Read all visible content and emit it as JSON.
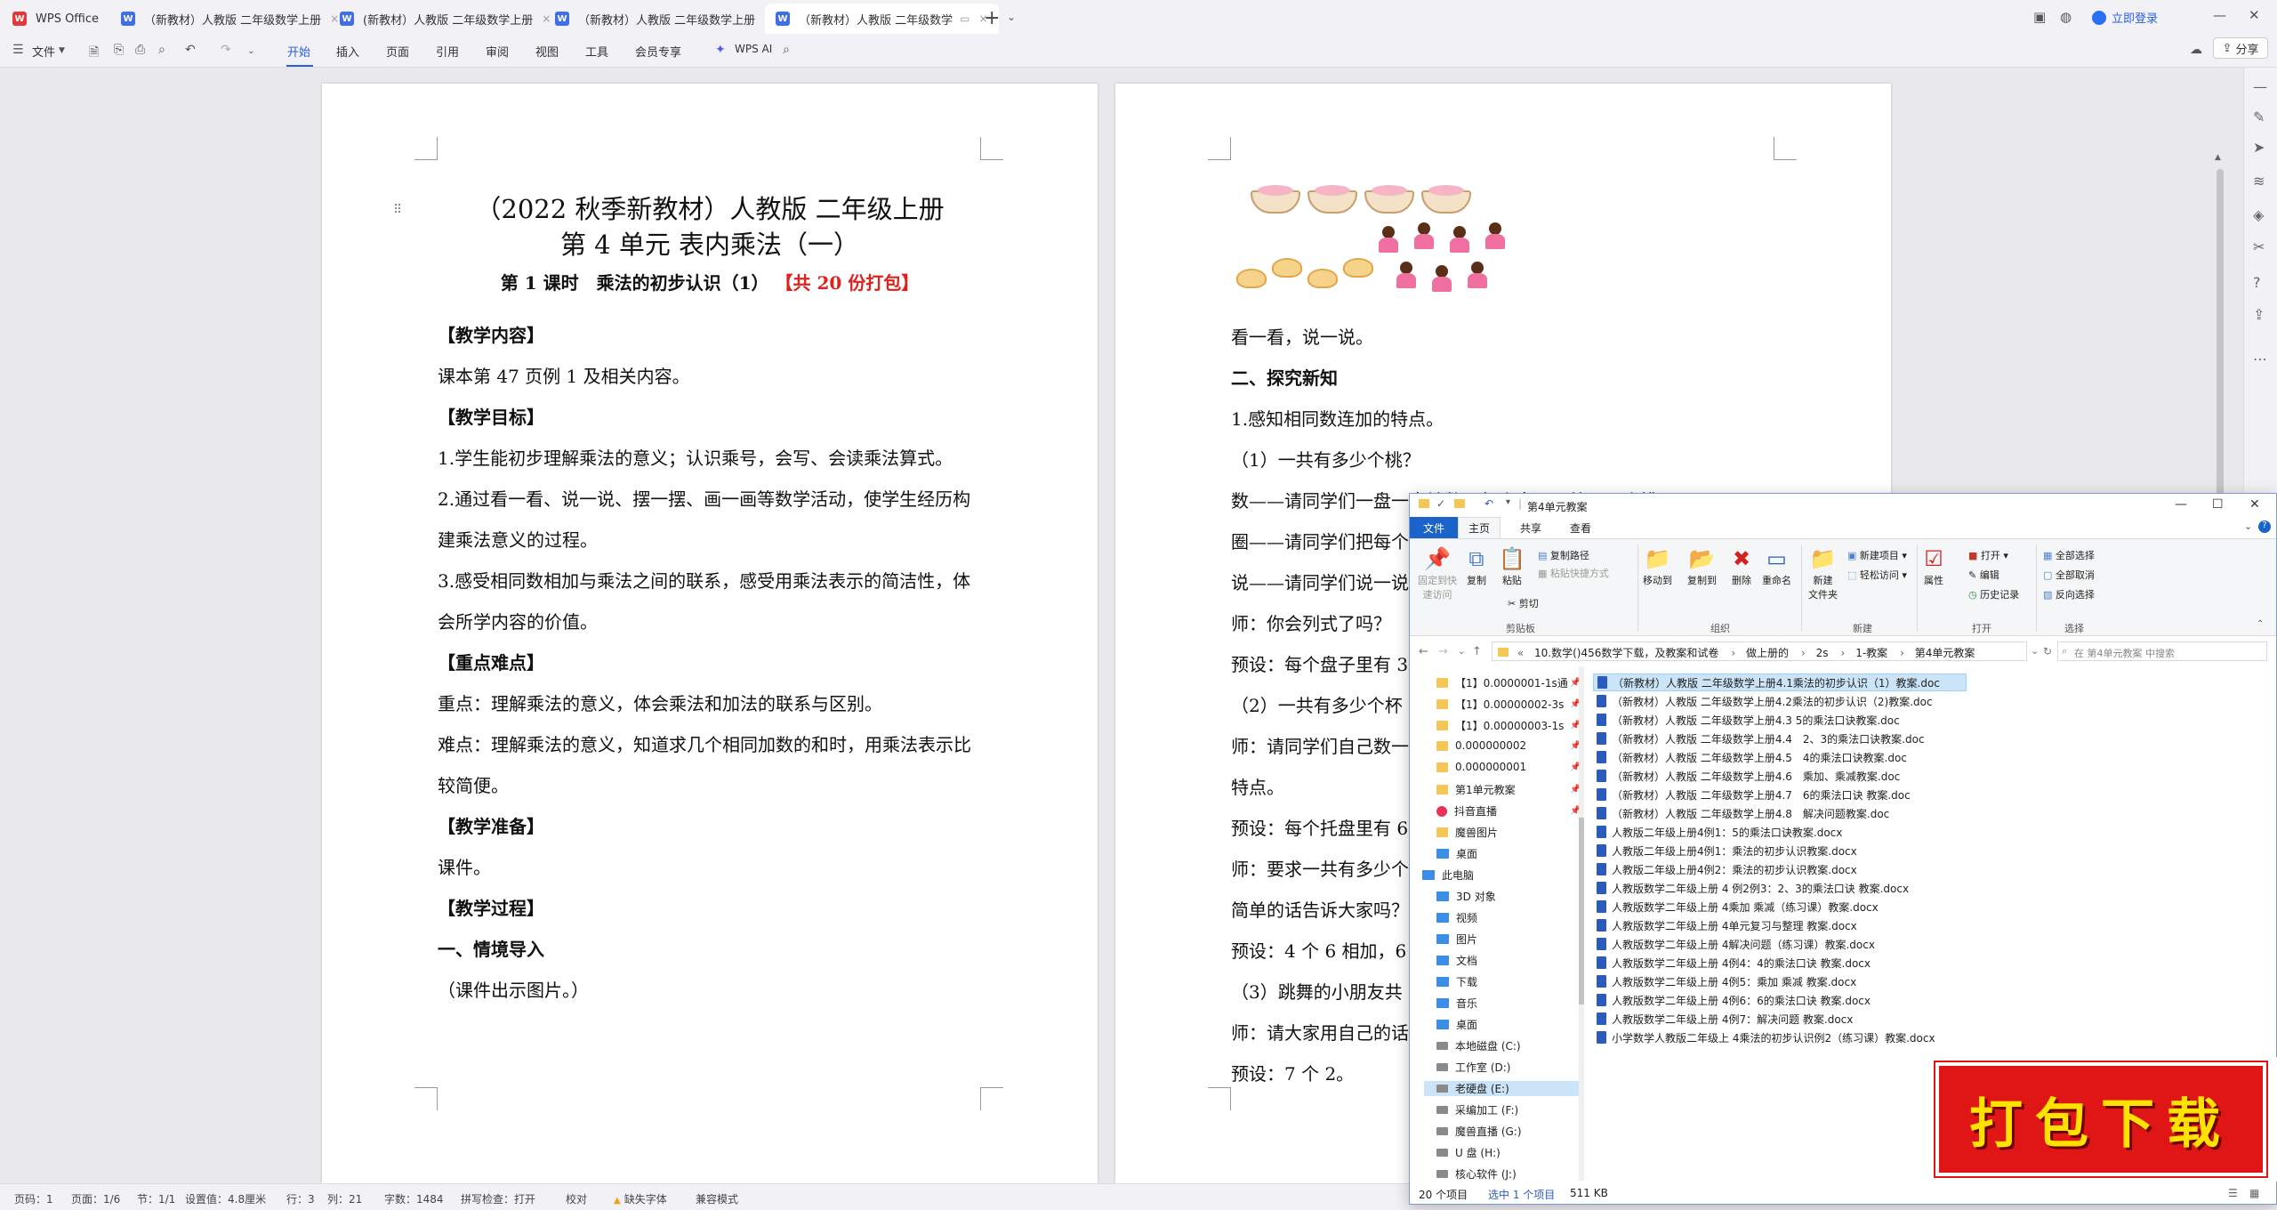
{
  "tabs": [
    {
      "label": "WPS Office"
    },
    {
      "label": "（新教材）人教版 二年级数学上册"
    },
    {
      "label": "(新教材）人教版 二年级数学上册"
    },
    {
      "label": "（新教材）人教版 二年级数学上册"
    },
    {
      "label": "（新教材）人教版 二年级数学"
    }
  ],
  "login_label": "立即登录",
  "share_label": "分享",
  "ribbon": {
    "file_label": "文件",
    "menus": [
      "开始",
      "插入",
      "页面",
      "引用",
      "审阅",
      "视图",
      "工具",
      "会员专享"
    ],
    "wps_ai": "WPS AI"
  },
  "page1": {
    "title_line1": "（2022 秋季新教材）人教版 二年级上册",
    "title_line2": "第 4 单元 表内乘法（一）",
    "lesson": "第 1 课时　乘法的初步认识（1）",
    "lesson_red": "【共 20 份打包】",
    "lines": [
      {
        "text": "【教学内容】",
        "bold": true
      },
      {
        "text": "课本第 47 页例 1 及相关内容。",
        "bold": false
      },
      {
        "text": "【教学目标】",
        "bold": true
      },
      {
        "text": "1.学生能初步理解乘法的意义；认识乘号，会写、会读乘法算式。",
        "bold": false
      },
      {
        "text": "2.通过看一看、说一说、摆一摆、画一画等数学活动，使学生经历构",
        "bold": false
      },
      {
        "text": "建乘法意义的过程。",
        "bold": false
      },
      {
        "text": "3.感受相同数相加与乘法之间的联系，感受用乘法表示的简洁性，体",
        "bold": false
      },
      {
        "text": "会所学内容的价值。",
        "bold": false
      },
      {
        "text": "【重点难点】",
        "bold": true
      },
      {
        "text": "重点：理解乘法的意义，体会乘法和加法的联系与区别。",
        "bold": false
      },
      {
        "text": "难点：理解乘法的意义，知道求几个相同加数的和时，用乘法表示比",
        "bold": false
      },
      {
        "text": "较简便。",
        "bold": false
      },
      {
        "text": "【教学准备】",
        "bold": true
      },
      {
        "text": "课件。",
        "bold": false
      },
      {
        "text": "【教学过程】",
        "bold": true
      },
      {
        "text": "一、情境导入",
        "bold": true
      },
      {
        "text": "（课件出示图片。）",
        "bold": false
      }
    ]
  },
  "page2": {
    "lines": [
      {
        "text": "看一看，说一说。",
        "bold": false
      },
      {
        "text": "二、探究新知",
        "bold": true
      },
      {
        "text": "1.感知相同数连加的特点。",
        "bold": false
      },
      {
        "text": "（1）一共有多少个桃？",
        "bold": false
      },
      {
        "text": "数——请同学们一盘一盘地数，每个盘子里放了几个桃？",
        "bold": false
      },
      {
        "text": "圈——请同学们把每个",
        "bold": false
      },
      {
        "text": "说——请同学们说一说",
        "bold": false
      },
      {
        "text": "师：你会列式了吗？",
        "bold": false
      },
      {
        "text": "预设：每个盘子里有 3",
        "bold": false
      },
      {
        "text": "（2）一共有多少个杯",
        "bold": false
      },
      {
        "text": "师：请同学们自己数一",
        "bold": false
      },
      {
        "text": "特点。",
        "bold": false
      },
      {
        "text": "预设：每个托盘里有 6",
        "bold": false
      },
      {
        "text": "师：要求一共有多少个",
        "bold": false
      },
      {
        "text": "简单的话告诉大家吗？",
        "bold": false
      },
      {
        "text": "预设：4 个 6 相加，6",
        "bold": false
      },
      {
        "text": "（3）跳舞的小朋友共",
        "bold": false
      },
      {
        "text": "师：请大家用自己的话",
        "bold": false
      },
      {
        "text": "预设：7 个 2。",
        "bold": false
      }
    ]
  },
  "statusbar": {
    "page": "页码：1",
    "pages": "页面：1/6",
    "section": "节：1/1",
    "setting": "设置值：4.8厘米",
    "row": "行：3",
    "col": "列：21",
    "words": "字数：1484",
    "spell": "拼写检查：打开",
    "proof": "校对",
    "missing_font": "缺失字体",
    "compat": "兼容模式"
  },
  "explorer": {
    "title": "第4单元教案",
    "tabs": {
      "file": "文件",
      "home": "主页",
      "share": "共享",
      "view": "查看"
    },
    "ribbon": {
      "pin": "固定到快\n速访问",
      "copy": "复制",
      "paste": "粘贴",
      "copy_path": "复制路径",
      "paste_shortcut": "粘贴快捷方式",
      "cut": "剪切",
      "clipboard": "剪贴板",
      "move_to": "移动到",
      "copy_to": "复制到",
      "delete": "删除",
      "rename": "重命名",
      "organize": "组织",
      "new_folder": "新建\n文件夹",
      "new_item": "新建项目",
      "easy_access": "轻松访问",
      "new_group": "新建",
      "properties": "属性",
      "open": "打开",
      "edit": "编辑",
      "history": "历史记录",
      "open_group": "打开",
      "select_all": "全部选择",
      "select_none": "全部取消",
      "invert": "反向选择",
      "select_group": "选择"
    },
    "address": [
      "10.数学()456数学下载，及教案和试卷",
      "做上册的",
      "2s",
      "1-教案",
      "第4单元教案"
    ],
    "search_placeholder": "在 第4单元教案 中搜索",
    "nav": [
      {
        "label": "【1】0.0000001-1s通",
        "type": "folder",
        "pin": true
      },
      {
        "label": "【1】0.00000002-3s",
        "type": "folder",
        "pin": true
      },
      {
        "label": "【1】0.00000003-1s",
        "type": "folder",
        "pin": true
      },
      {
        "label": "0.000000002",
        "type": "folder",
        "pin": true
      },
      {
        "label": "0.000000001",
        "type": "folder",
        "pin": true
      },
      {
        "label": "第1单元教案",
        "type": "folder",
        "pin": true
      },
      {
        "label": "抖音直播",
        "type": "app",
        "pin": true
      },
      {
        "label": "魔兽图片",
        "type": "folder",
        "pin": false
      },
      {
        "label": "桌面",
        "type": "pc",
        "pin": false
      },
      {
        "label": "此电脑",
        "type": "pc",
        "pin": false
      },
      {
        "label": "3D 对象",
        "type": "pc",
        "pin": false
      },
      {
        "label": "视频",
        "type": "pc",
        "pin": false
      },
      {
        "label": "图片",
        "type": "pc",
        "pin": false
      },
      {
        "label": "文档",
        "type": "pc",
        "pin": false
      },
      {
        "label": "下载",
        "type": "pc",
        "pin": false
      },
      {
        "label": "音乐",
        "type": "pc",
        "pin": false
      },
      {
        "label": "桌面",
        "type": "pc",
        "pin": false
      },
      {
        "label": "本地磁盘 (C:)",
        "type": "drive",
        "pin": false
      },
      {
        "label": "工作室 (D:)",
        "type": "drive",
        "pin": false
      },
      {
        "label": "老硬盘 (E:)",
        "type": "drive",
        "pin": false,
        "selected": true
      },
      {
        "label": "采编加工 (F:)",
        "type": "drive",
        "pin": false
      },
      {
        "label": "魔兽直播 (G:)",
        "type": "drive",
        "pin": false
      },
      {
        "label": "U 盘 (H:)",
        "type": "drive",
        "pin": false
      },
      {
        "label": "核心软件 (J:)",
        "type": "drive",
        "pin": false
      }
    ],
    "files": [
      "（新教材）人教版 二年级数学上册4.1乘法的初步认识（1）教案.doc",
      "（新教材）人教版 二年级数学上册4.2乘法的初步认识（2)教案.doc",
      "（新教材）人教版 二年级数学上册4.3 5的乘法口诀教案.doc",
      "（新教材）人教版 二年级数学上册4.4　2、3的乘法口诀教案.doc",
      "（新教材）人教版 二年级数学上册4.5　4的乘法口诀教案.doc",
      "（新教材）人教版 二年级数学上册4.6　乘加、乘减教案.doc",
      "（新教材）人教版 二年级数学上册4.7　6的乘法口诀 教案.doc",
      "（新教材）人教版 二年级数学上册4.8　解决问题教案.doc",
      "人教版二年级上册4例1：5的乘法口诀教案.docx",
      "人教版二年级上册4例1：乘法的初步认识教案.docx",
      "人教版二年级上册4例2：乘法的初步认识教案.docx",
      "人教版数学二年级上册 4 例2例3：2、3的乘法口诀 教案.docx",
      "人教版数学二年级上册 4乘加 乘减（练习课）教案.docx",
      "人教版数学二年级上册 4单元复习与整理 教案.docx",
      "人教版数学二年级上册 4解决问题（练习课）教案.docx",
      "人教版数学二年级上册 4例4：4的乘法口诀 教案.docx",
      "人教版数学二年级上册 4例5：乘加 乘减 教案.docx",
      "人教版数学二年级上册 4例6：6的乘法口诀 教案.docx",
      "人教版数学二年级上册 4例7：解决问题 教案.docx",
      "小学数学人教版二年级上 4乘法的初步认识例2（练习课）教案.docx"
    ],
    "status_count": "20 个项目",
    "status_selected": "选中 1 个项目",
    "status_size": "511 KB"
  },
  "banner_text": "打包下载"
}
